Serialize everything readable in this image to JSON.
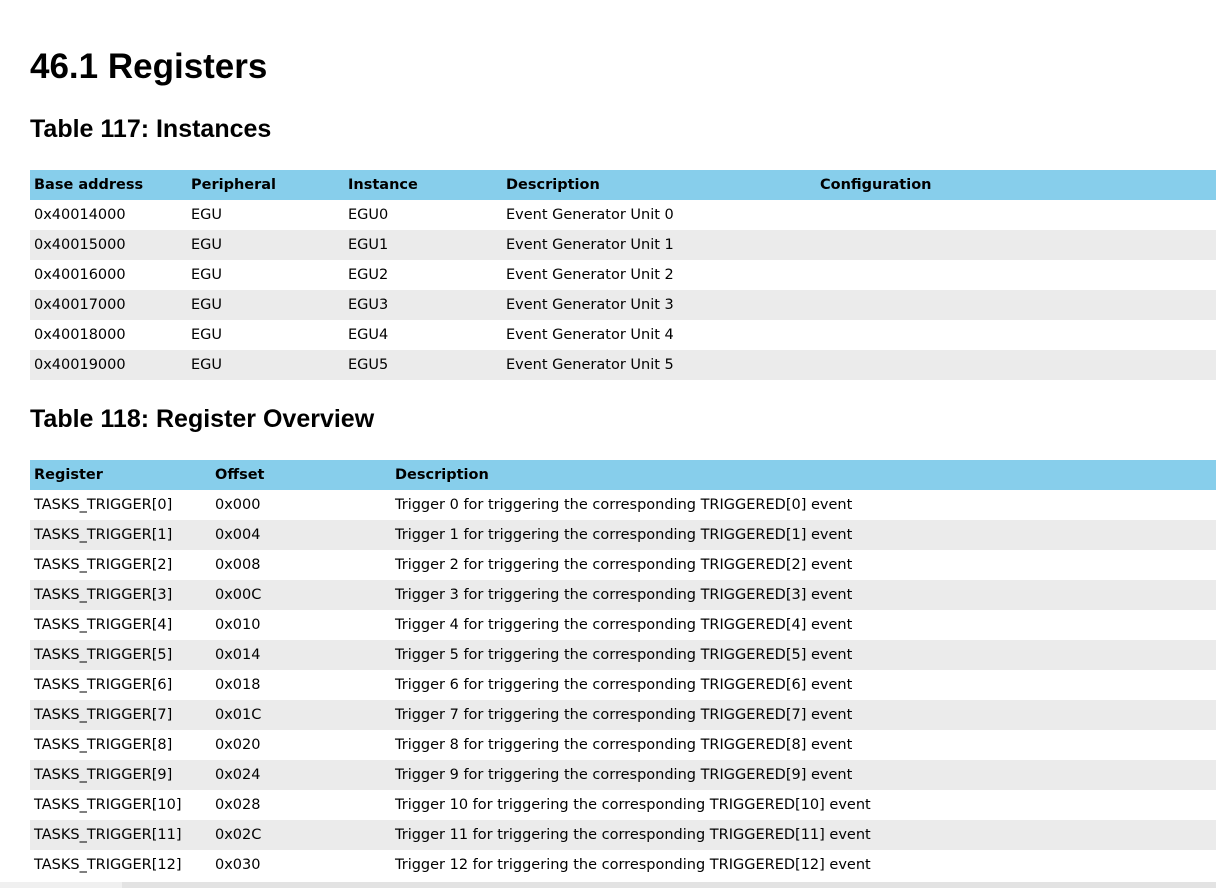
{
  "section": {
    "heading": "46.1 Registers"
  },
  "instances_table": {
    "caption": "Table 117: Instances",
    "headers": [
      "Base address",
      "Peripheral",
      "Instance",
      "Description",
      "Configuration"
    ],
    "rows": [
      [
        "0x40014000",
        "EGU",
        "EGU0",
        "Event Generator Unit 0",
        ""
      ],
      [
        "0x40015000",
        "EGU",
        "EGU1",
        "Event Generator Unit 1",
        ""
      ],
      [
        "0x40016000",
        "EGU",
        "EGU2",
        "Event Generator Unit 2",
        ""
      ],
      [
        "0x40017000",
        "EGU",
        "EGU3",
        "Event Generator Unit 3",
        ""
      ],
      [
        "0x40018000",
        "EGU",
        "EGU4",
        "Event Generator Unit 4",
        ""
      ],
      [
        "0x40019000",
        "EGU",
        "EGU5",
        "Event Generator Unit 5",
        ""
      ]
    ]
  },
  "overview_table": {
    "caption": "Table 118: Register Overview",
    "headers": [
      "Register",
      "Offset",
      "Description"
    ],
    "rows": [
      [
        "TASKS_TRIGGER[0]",
        "0x000",
        "Trigger 0 for triggering the corresponding TRIGGERED[0] event"
      ],
      [
        "TASKS_TRIGGER[1]",
        "0x004",
        "Trigger 1 for triggering the corresponding TRIGGERED[1] event"
      ],
      [
        "TASKS_TRIGGER[2]",
        "0x008",
        "Trigger 2 for triggering the corresponding TRIGGERED[2] event"
      ],
      [
        "TASKS_TRIGGER[3]",
        "0x00C",
        "Trigger 3 for triggering the corresponding TRIGGERED[3] event"
      ],
      [
        "TASKS_TRIGGER[4]",
        "0x010",
        "Trigger 4 for triggering the corresponding TRIGGERED[4] event"
      ],
      [
        "TASKS_TRIGGER[5]",
        "0x014",
        "Trigger 5 for triggering the corresponding TRIGGERED[5] event"
      ],
      [
        "TASKS_TRIGGER[6]",
        "0x018",
        "Trigger 6 for triggering the corresponding TRIGGERED[6] event"
      ],
      [
        "TASKS_TRIGGER[7]",
        "0x01C",
        "Trigger 7 for triggering the corresponding TRIGGERED[7] event"
      ],
      [
        "TASKS_TRIGGER[8]",
        "0x020",
        "Trigger 8 for triggering the corresponding TRIGGERED[8] event"
      ],
      [
        "TASKS_TRIGGER[9]",
        "0x024",
        "Trigger 9 for triggering the corresponding TRIGGERED[9] event"
      ],
      [
        "TASKS_TRIGGER[10]",
        "0x028",
        "Trigger 10 for triggering the corresponding TRIGGERED[10] event"
      ],
      [
        "TASKS_TRIGGER[11]",
        "0x02C",
        "Trigger 11 for triggering the corresponding TRIGGERED[11] event"
      ],
      [
        "TASKS_TRIGGER[12]",
        "0x030",
        "Trigger 12 for triggering the corresponding TRIGGERED[12] event"
      ]
    ]
  },
  "colors": {
    "header_background": "#87ceeb",
    "zebra_row_background": "#ebebeb"
  }
}
